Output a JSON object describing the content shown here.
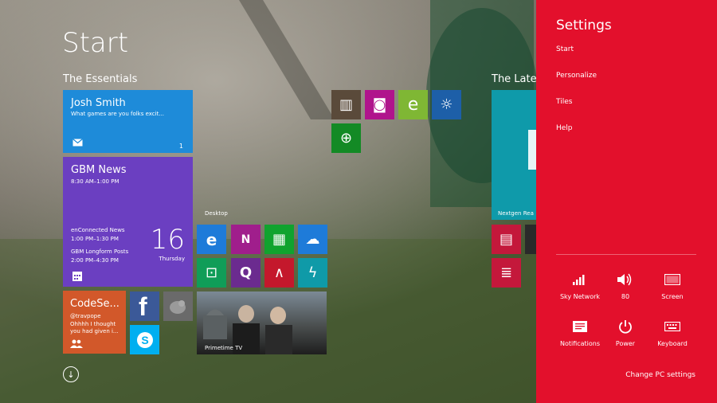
{
  "start_title": "Start",
  "groups": {
    "essentials": "The Essentials",
    "latest": "The Lates"
  },
  "tiles": {
    "josh": {
      "name": "Josh Smith",
      "msg": "What games are you folks excit...",
      "count": "1"
    },
    "gbm": {
      "title": "GBM News",
      "time1": "8:30 AM–1:00 PM",
      "event2": "enConnected News",
      "time2": "1:00 PM–1:30 PM",
      "event3": "GBM Longform Posts",
      "time3": "2:00 PM–4:30 PM",
      "day": "16",
      "weekday": "Thursday"
    },
    "code": {
      "title": "CodeSe...",
      "handle": "@travpope",
      "msg1": "Ohhhh I thought",
      "msg2": "you had given i..."
    },
    "desktop": "Desktop",
    "primetime": "Primetime TV",
    "nextgen": "Nextgen Rea"
  },
  "settings": {
    "header": "Settings",
    "links": [
      "Start",
      "Personalize",
      "Tiles",
      "Help"
    ],
    "quick": [
      {
        "label": "Sky Network",
        "icon": "signal-icon"
      },
      {
        "label": "80",
        "icon": "volume-icon"
      },
      {
        "label": "Screen",
        "icon": "screen-icon"
      },
      {
        "label": "Notifications",
        "icon": "notifications-icon"
      },
      {
        "label": "Power",
        "icon": "power-icon"
      },
      {
        "label": "Keyboard",
        "icon": "keyboard-icon"
      }
    ],
    "change": "Change PC settings"
  },
  "colors": {
    "settings_bg": "#e3102c",
    "mail": "#1e8bd9",
    "calendar": "#6b3fc1",
    "twitter_app": "#d2582a"
  }
}
